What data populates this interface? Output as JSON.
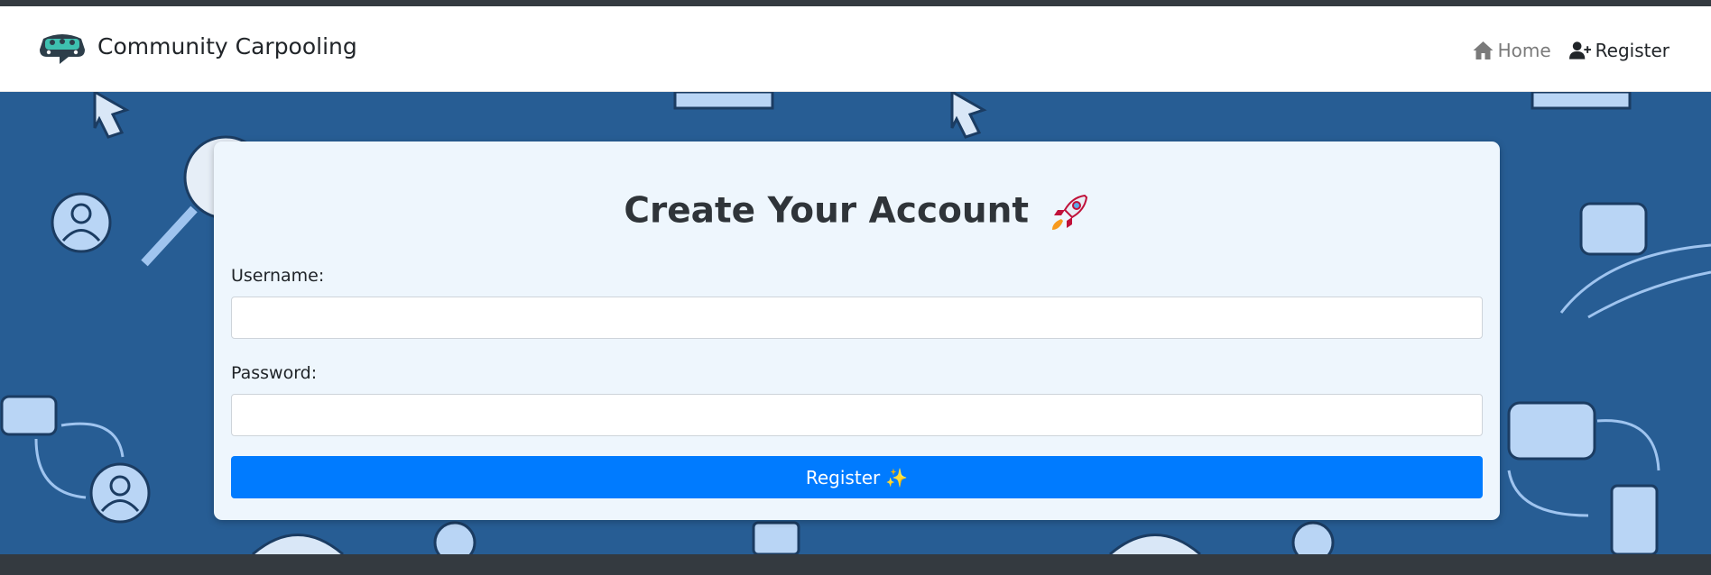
{
  "brand": {
    "name": "Community Carpooling",
    "logo_icon": "carpool-car-logo-icon"
  },
  "nav": {
    "home_label": "Home",
    "home_icon": "home-icon",
    "register_label": "Register",
    "register_icon": "user-plus-icon"
  },
  "form": {
    "title": "Create Your Account",
    "title_icon": "rocket-icon",
    "username_label": "Username:",
    "username_value": "",
    "password_label": "Password:",
    "password_value": "",
    "submit_label": "Register",
    "submit_icon": "sparkles-icon"
  },
  "colors": {
    "hero_background": "#275d94",
    "primary_button": "#007bff",
    "card_background": "#eef6fd",
    "top_bar": "#343a40"
  }
}
